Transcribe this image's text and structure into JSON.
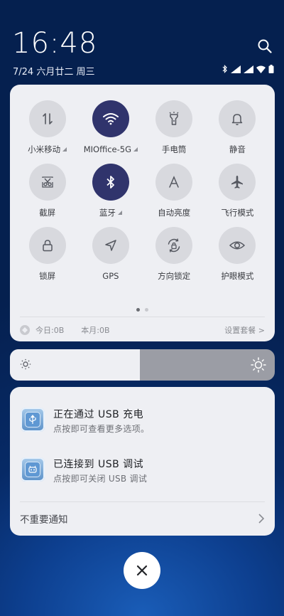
{
  "header": {
    "time": "16:48",
    "date": "7/24  六月廿二  周三"
  },
  "quick_settings": {
    "tiles": [
      {
        "label": "小米移动",
        "icon": "data-arrows-icon",
        "on": false,
        "has_caret": true
      },
      {
        "label": "MIOffice-5G",
        "icon": "wifi-icon",
        "on": true,
        "has_caret": true
      },
      {
        "label": "手电筒",
        "icon": "flashlight-icon",
        "on": false,
        "has_caret": false
      },
      {
        "label": "静音",
        "icon": "bell-icon",
        "on": false,
        "has_caret": false
      },
      {
        "label": "截屏",
        "icon": "scissors-icon",
        "on": false,
        "has_caret": false
      },
      {
        "label": "蓝牙",
        "icon": "bluetooth-icon",
        "on": true,
        "has_caret": true
      },
      {
        "label": "自动亮度",
        "icon": "auto-brightness-icon",
        "on": false,
        "has_caret": false
      },
      {
        "label": "飞行模式",
        "icon": "airplane-icon",
        "on": false,
        "has_caret": false
      },
      {
        "label": "锁屏",
        "icon": "lock-icon",
        "on": false,
        "has_caret": false
      },
      {
        "label": "GPS",
        "icon": "location-arrow-icon",
        "on": false,
        "has_caret": false
      },
      {
        "label": "方向锁定",
        "icon": "rotation-lock-icon",
        "on": false,
        "has_caret": false
      },
      {
        "label": "护眼模式",
        "icon": "eye-icon",
        "on": false,
        "has_caret": false
      }
    ],
    "page_count": 2,
    "active_page": 1,
    "data_today": "今日:0B",
    "data_month": "本月:0B",
    "settings_link": "设置套餐 >"
  },
  "brightness": {
    "level": 0.49
  },
  "notifications": {
    "items": [
      {
        "title": "正在通过 USB 充电",
        "subtitle": "点按即可查看更多选项。"
      },
      {
        "title": "已连接到 USB 调试",
        "subtitle": "点按即可关闭 USB 调试"
      }
    ],
    "unimportant_label": "不重要通知"
  },
  "colors": {
    "tile_active": "#30346c",
    "tile_inactive": "#d8d9de",
    "panel_bg": "#eeeff3"
  }
}
